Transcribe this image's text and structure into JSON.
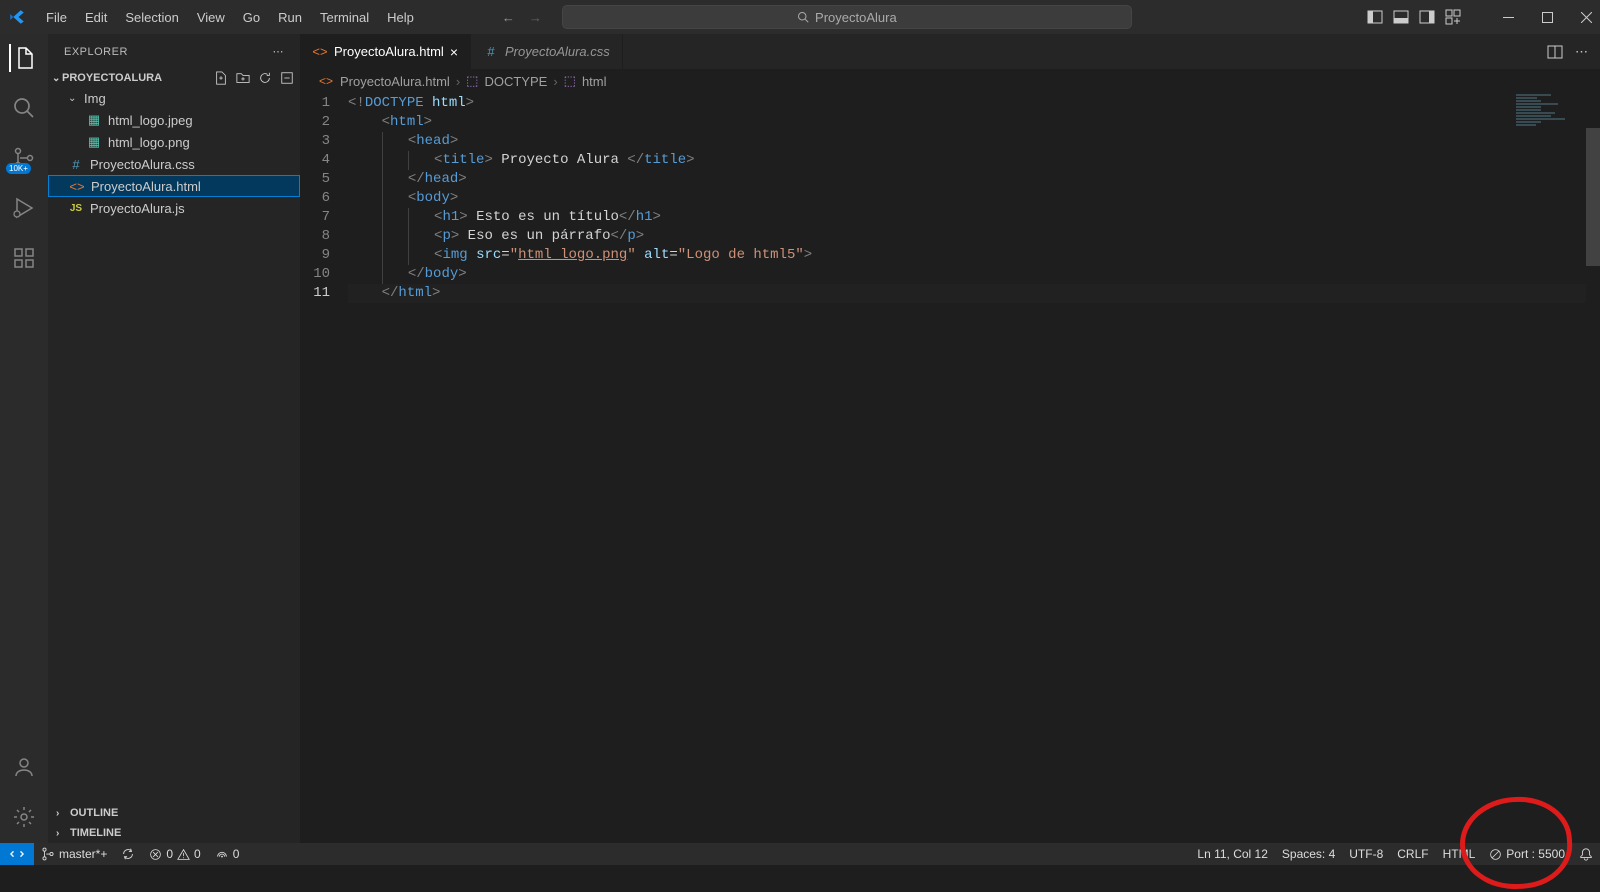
{
  "menu": [
    "File",
    "Edit",
    "Selection",
    "View",
    "Go",
    "Run",
    "Terminal",
    "Help"
  ],
  "search_placeholder": "ProyectoAlura",
  "explorer_title": "EXPLORER",
  "project_name": "PROYECTOALURA",
  "badge_text": "10K+",
  "tree": {
    "folder": "Img",
    "files_in_folder": [
      "html_logo.jpeg",
      "html_logo.png"
    ],
    "root_files": [
      {
        "name": "ProyectoAlura.css",
        "type": "css"
      },
      {
        "name": "ProyectoAlura.html",
        "type": "html",
        "selected": true
      },
      {
        "name": "ProyectoAlura.js",
        "type": "js"
      }
    ]
  },
  "outline": "OUTLINE",
  "timeline": "TIMELINE",
  "tabs": [
    {
      "name": "ProyectoAlura.html",
      "icon": "html",
      "active": true,
      "close": true
    },
    {
      "name": "ProyectoAlura.css",
      "icon": "css",
      "active": false,
      "italic": true
    }
  ],
  "breadcrumb": [
    "ProyectoAlura.html",
    "DOCTYPE",
    "html"
  ],
  "code": {
    "l1_doctype": "DOCTYPE",
    "l1_html": "html",
    "l2": "html",
    "l3": "head",
    "l4_tag": "title",
    "l4_text": " Proyecto Alura ",
    "l5": "head",
    "l6": "body",
    "l7_tag": "h1",
    "l7_text": " Esto es un título",
    "l8_tag": "p",
    "l8_text": " Eso es un párrafo",
    "l9_tag": "img",
    "l9_src_attr": "src",
    "l9_src": "html_logo.png",
    "l9_alt_attr": "alt",
    "l9_alt": "Logo de html5",
    "l10": "body",
    "l11": "html"
  },
  "line_numbers": [
    "1",
    "2",
    "3",
    "4",
    "5",
    "6",
    "7",
    "8",
    "9",
    "10",
    "11"
  ],
  "status": {
    "branch": "master*+",
    "errors": "0",
    "warnings": "0",
    "ports": "0",
    "lncol": "Ln 11, Col 12",
    "spaces": "Spaces: 4",
    "encoding": "UTF-8",
    "eol": "CRLF",
    "lang": "HTML",
    "port": "Port : 5500"
  }
}
